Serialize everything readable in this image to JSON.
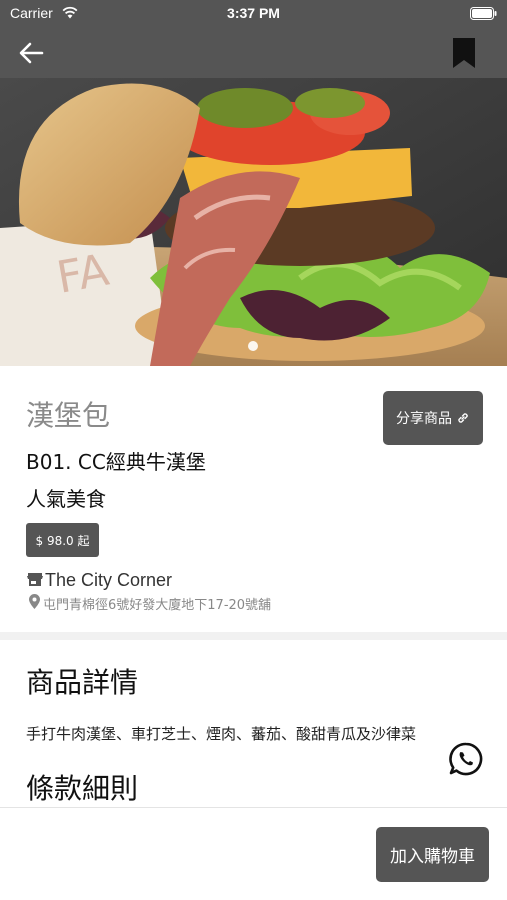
{
  "status_bar": {
    "carrier": "Carrier",
    "time": "3:37 PM"
  },
  "nav": {
    "back_icon": "arrow-left-icon",
    "bookmark_icon": "bookmark-icon"
  },
  "hero": {
    "image_subject": "burger photo",
    "active_slide": 1,
    "slide_count": 1
  },
  "product": {
    "category": "漢堡包",
    "name": "B01. CC經典牛漢堡",
    "tag": "人氣美食",
    "price": "$ 98.0 起",
    "share_label": "分享商品",
    "store_name": "The City Corner",
    "store_address": "屯門青棉徑6號好發大廈地下17-20號舖"
  },
  "details": {
    "heading": "商品詳情",
    "description": "手打牛肉漢堡、車打芝士、煙肉、蕃茄、酸甜青瓜及沙律菜",
    "terms_heading": "條款細則"
  },
  "footer": {
    "add_to_cart": "加入購物車"
  },
  "colors": {
    "header_bg": "#555555",
    "button_bg": "#555555",
    "category_text": "#8a8a8a"
  }
}
